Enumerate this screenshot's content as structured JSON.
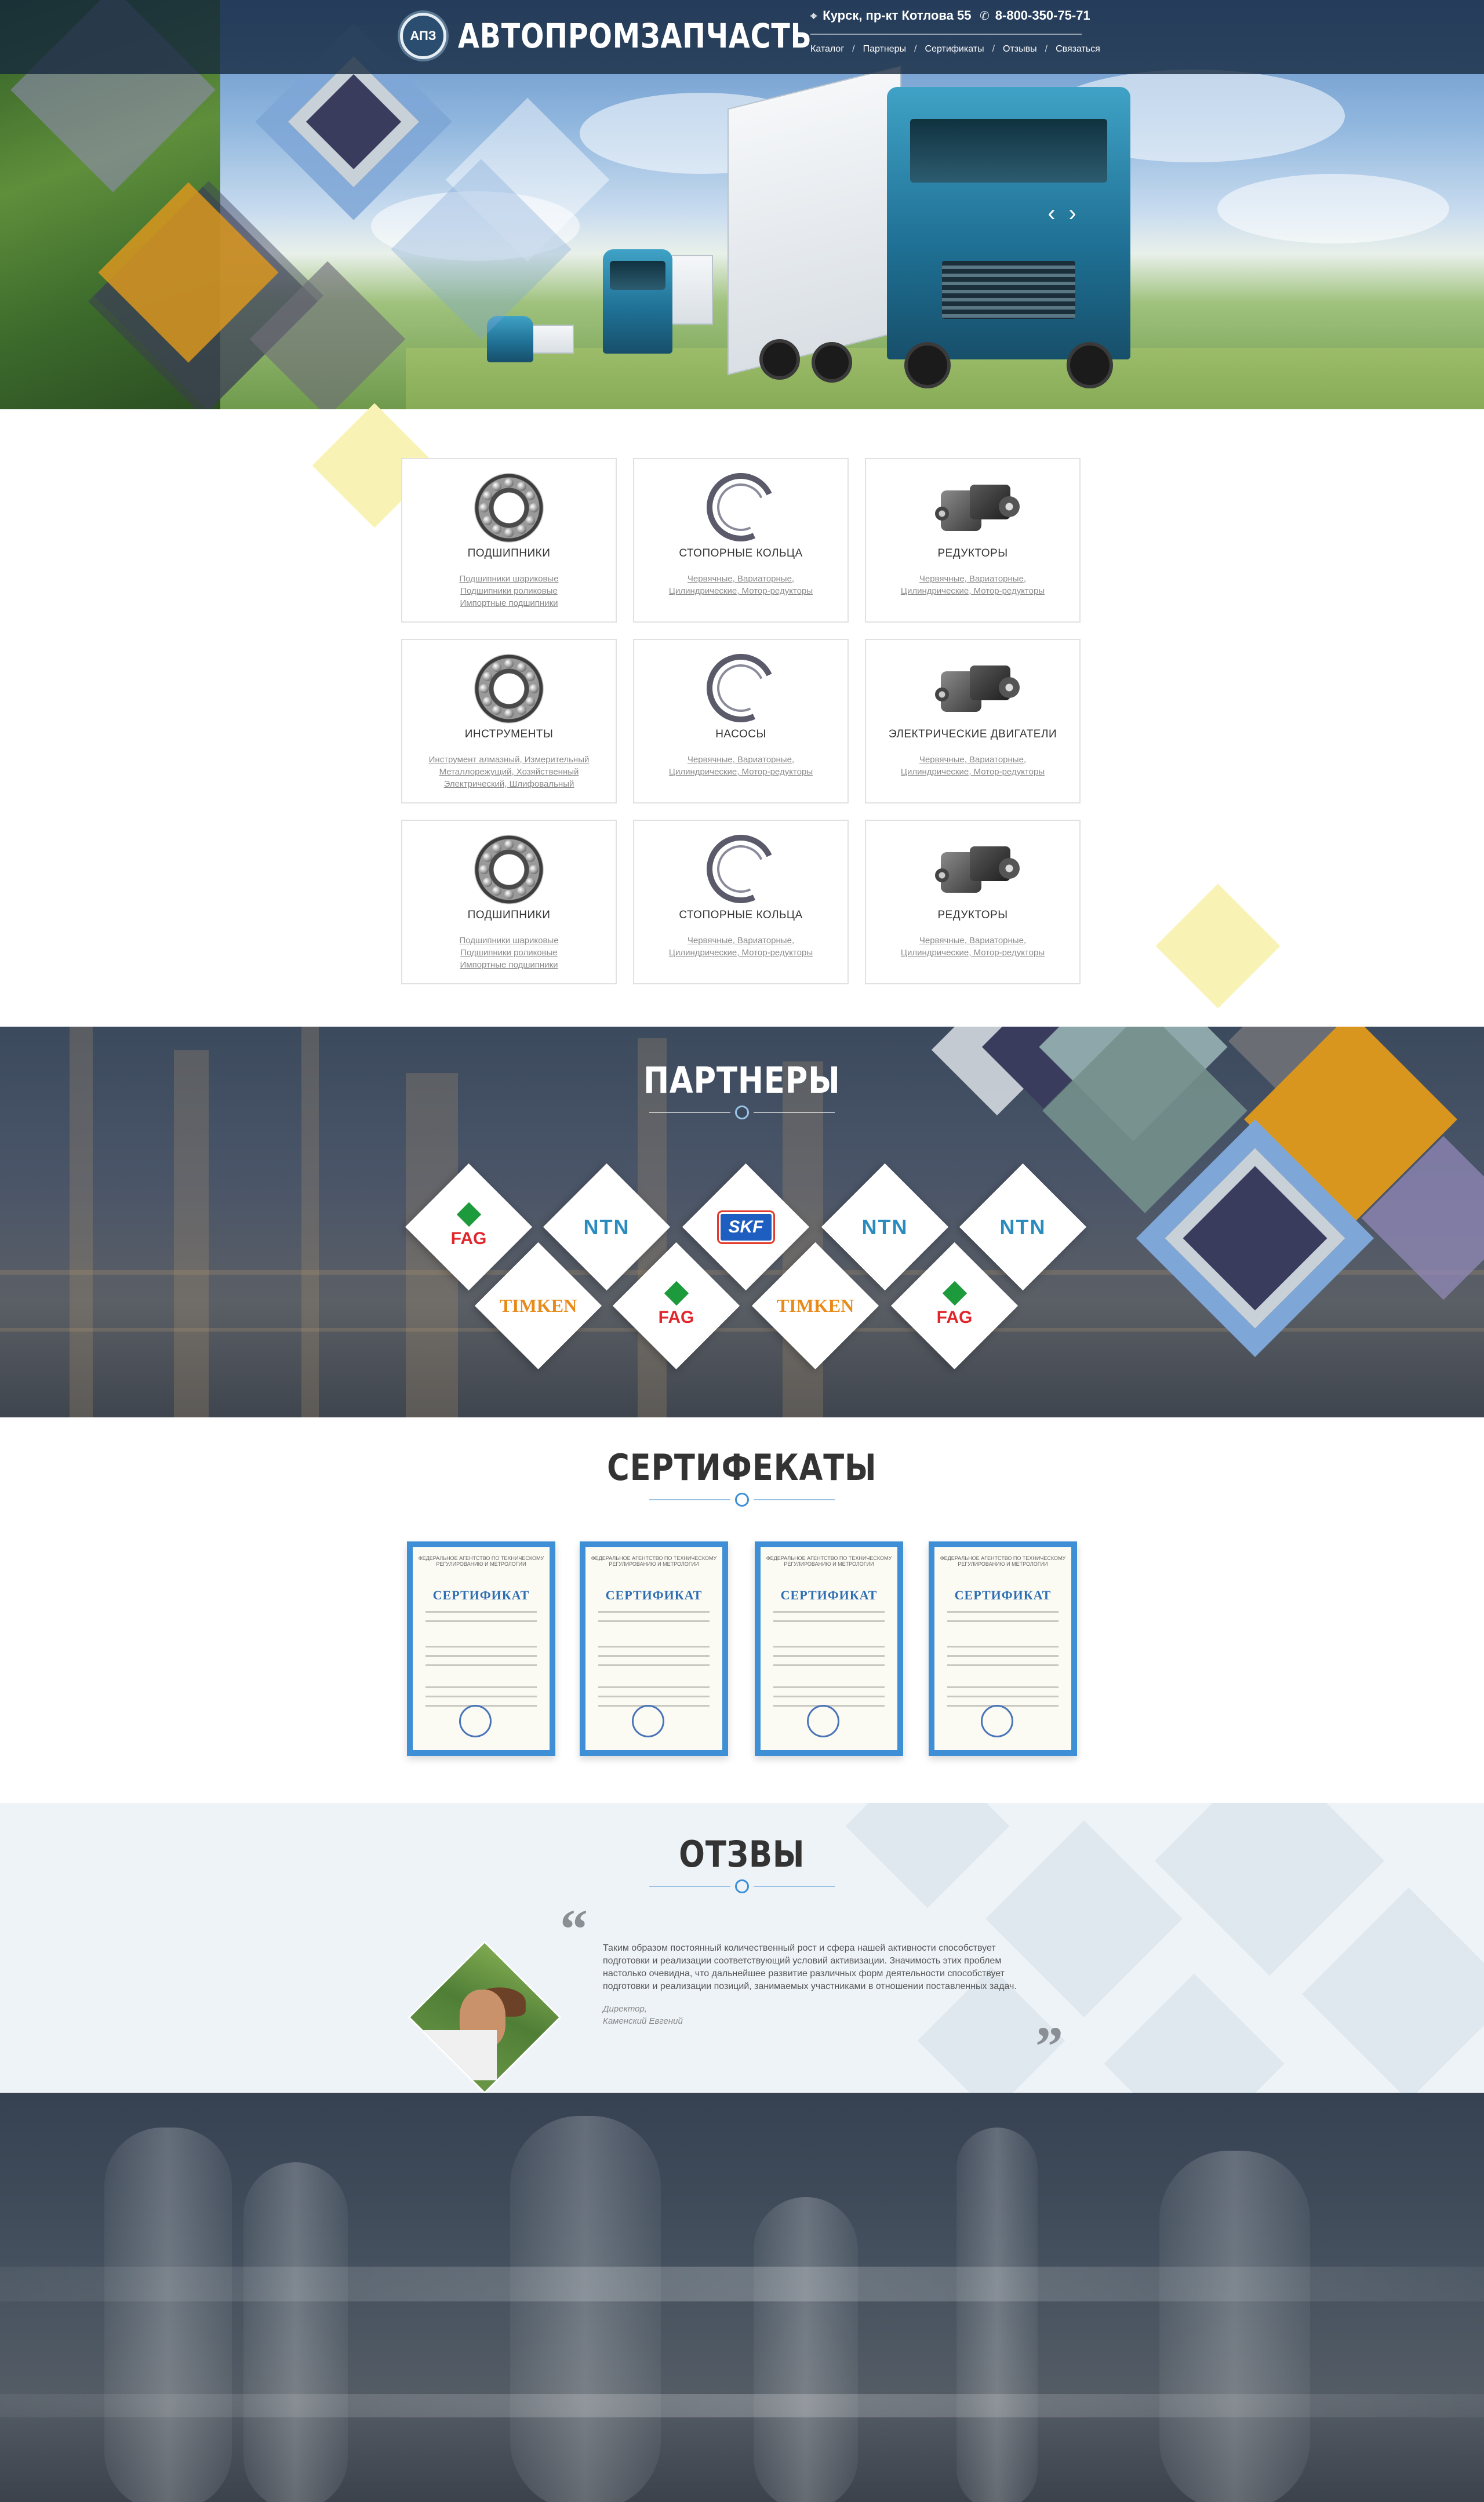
{
  "header": {
    "logo_badge": "АПЗ",
    "logo_text": "АВТОПРОМЗАПЧАСТЬ",
    "address": "Курск,  пр-кт Котлова 55",
    "phone": "8-800-350-75-71",
    "nav": [
      "Каталог",
      "Партнеры",
      "Сертификаты",
      "Отзывы",
      "Связаться"
    ]
  },
  "catalog": {
    "cards": [
      {
        "name": "ПОДШИПНИКИ",
        "icon": "bearing-icon",
        "links": [
          "Подшипники шариковые",
          "Подшипники роликовые",
          "Импортные подшипники"
        ]
      },
      {
        "name": "СТОПОРНЫЕ  КОЛЬЦА",
        "icon": "retaining-ring-icon",
        "links": [
          "Червячные,  Вариаторные,",
          "Цилиндрические,  Мотор-редукторы"
        ]
      },
      {
        "name": "РЕДУКТОРЫ",
        "icon": "gearbox-icon",
        "links": [
          "Червячные,  Вариаторные,",
          "Цилиндрические,  Мотор-редукторы"
        ]
      },
      {
        "name": "ИНСТРУМЕНТЫ",
        "icon": "bearing-icon",
        "links": [
          "Инструмент алмазный, Измерительный",
          "Металлорежущий, Хозяйственный",
          "Электрический, Шлифовальный"
        ]
      },
      {
        "name": "НАСОСЫ",
        "icon": "retaining-ring-icon",
        "links": [
          "Червячные,  Вариаторные,",
          "Цилиндрические,  Мотор-редукторы"
        ]
      },
      {
        "name": "ЭЛЕКТРИЧЕСКИЕ ДВИГАТЕЛИ",
        "icon": "gearbox-icon",
        "links": [
          "Червячные,  Вариаторные,",
          "Цилиндрические,  Мотор-редукторы"
        ]
      },
      {
        "name": "ПОДШИПНИКИ",
        "icon": "bearing-icon",
        "links": [
          "Подшипники шариковые",
          "Подшипники роликовые",
          "Импортные подшипники"
        ]
      },
      {
        "name": "СТОПОРНЫЕ  КОЛЬЦА",
        "icon": "retaining-ring-icon",
        "links": [
          "Червячные,  Вариаторные,",
          "Цилиндрические,  Мотор-редукторы"
        ]
      },
      {
        "name": "РЕДУКТОРЫ",
        "icon": "gearbox-icon",
        "links": [
          "Червячные,  Вариаторные,",
          "Цилиндрические,  Мотор-редукторы"
        ]
      }
    ]
  },
  "partners": {
    "title": "ПАРТНЕРЫ",
    "top_row": [
      "FAG",
      "NTN",
      "SKF",
      "NTN",
      "NTN"
    ],
    "bottom_row": [
      "TIMKEN",
      "FAG",
      "TIMKEN",
      "FAG"
    ]
  },
  "certificates": {
    "title": "СЕРТИФЕКАТЫ",
    "cert_header": "ФЕДЕРАЛЬНОЕ АГЕНТСТВО ПО ТЕХНИЧЕСКОМУ РЕГУЛИРОВАНИЮ И МЕТРОЛОГИИ",
    "cert_title": "СЕРТИФИКАТ",
    "count": 4
  },
  "reviews": {
    "title": "ОТЗВЫ",
    "text": "Таким образом постоянный количественный рост и сфера нашей активности способствует подготовки и реализации соответствующий условий активизации. Значимость этих проблем настолько очевидна, что дальнейшее развитие различных форм деятельности способствует подготовки и реализации позиций, занимаемых участниками в отношении поставленных задач.",
    "author_role": "Директор,",
    "author_name": "Каменский Евгений"
  },
  "colors": {
    "accent_blue": "#7ea6d6",
    "accent_orange": "#d9961f",
    "accent_navy": "#3a3c5e",
    "accent_teal": "#6d8f8d",
    "accent_yellow": "#f5f0a6",
    "title_dark": "#333333"
  }
}
